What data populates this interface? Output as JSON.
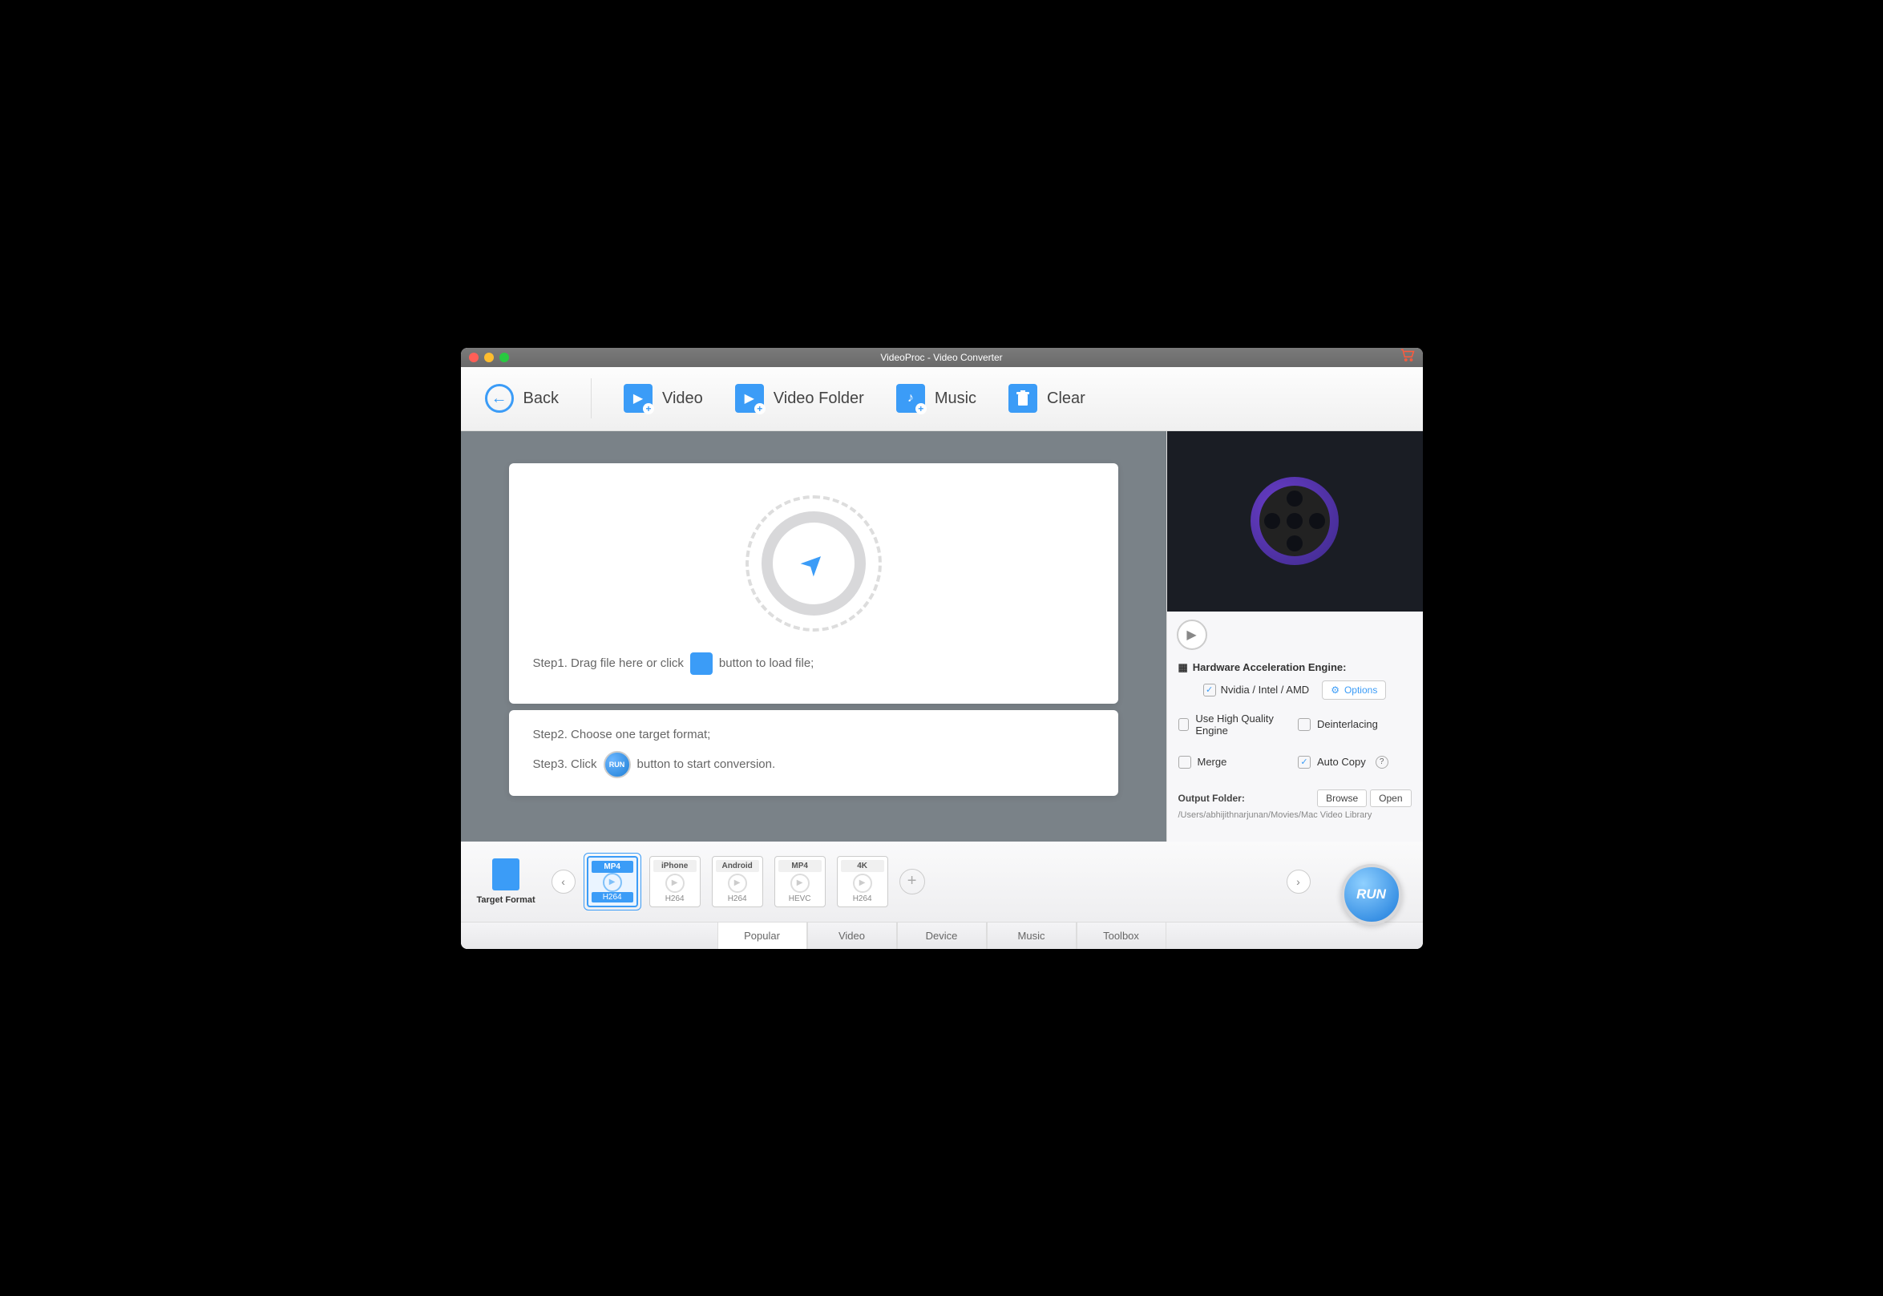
{
  "window": {
    "title": "VideoProc - Video Converter"
  },
  "toolbar": {
    "back": "Back",
    "video": "Video",
    "folder": "Video Folder",
    "music": "Music",
    "clear": "Clear"
  },
  "steps": {
    "s1a": "Step1. Drag file here or click",
    "s1b": "button to load file;",
    "s2": "Step2. Choose one target format;",
    "s3a": "Step3. Click",
    "s3b": "button to start conversion.",
    "run_small": "RUN"
  },
  "hw": {
    "title": "Hardware Acceleration Engine:",
    "nvidia": "Nvidia / Intel / AMD",
    "options": "Options",
    "hq": "Use High Quality Engine",
    "deint": "Deinterlacing",
    "merge": "Merge",
    "auto": "Auto Copy"
  },
  "output": {
    "label": "Output Folder:",
    "browse": "Browse",
    "open": "Open",
    "path": "/Users/abhijithnarjunan/Movies/Mac Video Library"
  },
  "tf_label": "Target Format",
  "formats": [
    {
      "top": "MP4",
      "bot": "H264",
      "sel": true
    },
    {
      "top": "iPhone",
      "bot": "H264",
      "sel": false
    },
    {
      "top": "Android",
      "bot": "H264",
      "sel": false
    },
    {
      "top": "MP4",
      "bot": "HEVC",
      "sel": false
    },
    {
      "top": "4K",
      "bot": "H264",
      "sel": false
    }
  ],
  "tabs": [
    "Popular",
    "Video",
    "Device",
    "Music",
    "Toolbox"
  ],
  "run": "RUN"
}
